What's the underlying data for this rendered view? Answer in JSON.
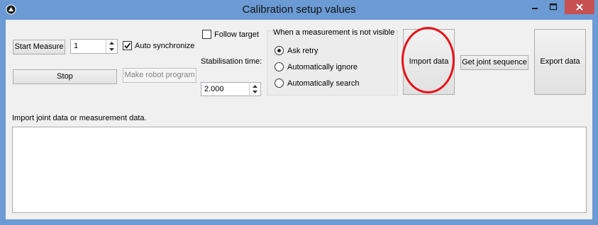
{
  "window": {
    "title": "Calibration setup values"
  },
  "measure": {
    "start_label": "Start Measure",
    "count_value": "1",
    "auto_sync_label": "Auto synchronize",
    "auto_sync_checked": true,
    "stop_label": "Stop",
    "make_program_label": "Make robot program"
  },
  "target": {
    "follow_label": "Follow target",
    "follow_checked": false,
    "stabilisation_label": "Stabilisation time:",
    "stabilisation_value": "2.000"
  },
  "not_visible": {
    "heading": "When a measurement is not visible",
    "options": [
      "Ask retry",
      "Automatically ignore",
      "Automatically search"
    ],
    "selected": "Ask retry"
  },
  "actions": {
    "import_label": "Import data",
    "joint_sequence_label": "Get joint sequence",
    "export_label": "Export data"
  },
  "log": {
    "label": "Import joint data or measurement data.",
    "content": ""
  },
  "colors": {
    "titlebar": "#6b9ad4",
    "close": "#c75050",
    "highlight": "#e8101a"
  }
}
